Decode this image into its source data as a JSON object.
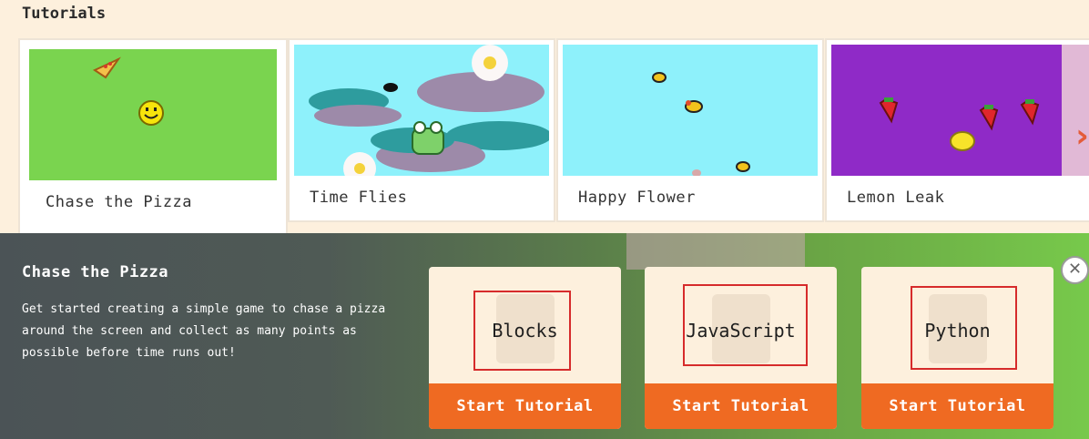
{
  "header": {
    "title": "Tutorials"
  },
  "cards": [
    {
      "label": "Chase the Pizza"
    },
    {
      "label": "Time Flies"
    },
    {
      "label": "Happy Flower"
    },
    {
      "label": "Lemon Leak"
    }
  ],
  "carousel": {
    "next_icon": "chevron-right-icon"
  },
  "detail": {
    "title": "Chase the Pizza",
    "description": "Get started creating a simple game to chase a pizza around the screen and collect as many points as possible before time runs out!",
    "options": [
      {
        "label": "Blocks",
        "button": "Start Tutorial",
        "icon": "puzzle-icon"
      },
      {
        "label": "JavaScript",
        "button": "Start Tutorial",
        "icon": "js-icon"
      },
      {
        "label": "Python",
        "button": "Start Tutorial",
        "icon": "python-icon"
      }
    ],
    "close_icon": "close-icon"
  },
  "colors": {
    "accent": "#ef6a22",
    "highlight_border": "#d62b2b",
    "background": "#fdf0dd"
  }
}
